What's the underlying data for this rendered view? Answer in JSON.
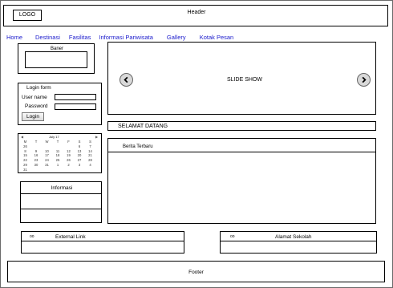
{
  "header": {
    "logo": "LOGO",
    "title": "Header"
  },
  "nav": [
    "Home",
    "Destinasi",
    "Fasilitas",
    "Informasi Pariwisata",
    "Gallery",
    "Kotak Pesan"
  ],
  "banner": {
    "label": "Baner"
  },
  "login": {
    "title": "Login form",
    "username_label": "User name",
    "password_label": "Password",
    "username_value": "",
    "password_value": "",
    "button_label": "Login"
  },
  "calendar": {
    "prev_icon": "◀",
    "next_icon": "▶",
    "title": "July 17",
    "weekdays": [
      "M",
      "T",
      "W",
      "T",
      "F",
      "S",
      "S"
    ],
    "rows": [
      [
        "26",
        "",
        "",
        "",
        "",
        "6",
        "7"
      ],
      [
        "8",
        "9",
        "10",
        "11",
        "12",
        "13",
        "14"
      ],
      [
        "15",
        "16",
        "17",
        "18",
        "19",
        "20",
        "21"
      ],
      [
        "22",
        "23",
        "24",
        "25",
        "26",
        "27",
        "28"
      ],
      [
        "29",
        "30",
        "31",
        "1",
        "2",
        "3",
        "4"
      ],
      [
        "31",
        "",
        "",
        "",
        "",
        "",
        ""
      ]
    ]
  },
  "info": {
    "title": "Informasi"
  },
  "slideshow": {
    "label": "SLIDE SHOW",
    "prev_icon": "chevron-left-icon",
    "next_icon": "chevron-right-icon"
  },
  "welcome": {
    "text": "SELAMAT DATANG"
  },
  "news": {
    "title": "Berita Terbaru"
  },
  "external_link": {
    "icon": "oo",
    "label": "External Link"
  },
  "school_address": {
    "icon": "oo",
    "label": "Alamat Sekolah"
  },
  "footer": {
    "text": "Footer"
  }
}
